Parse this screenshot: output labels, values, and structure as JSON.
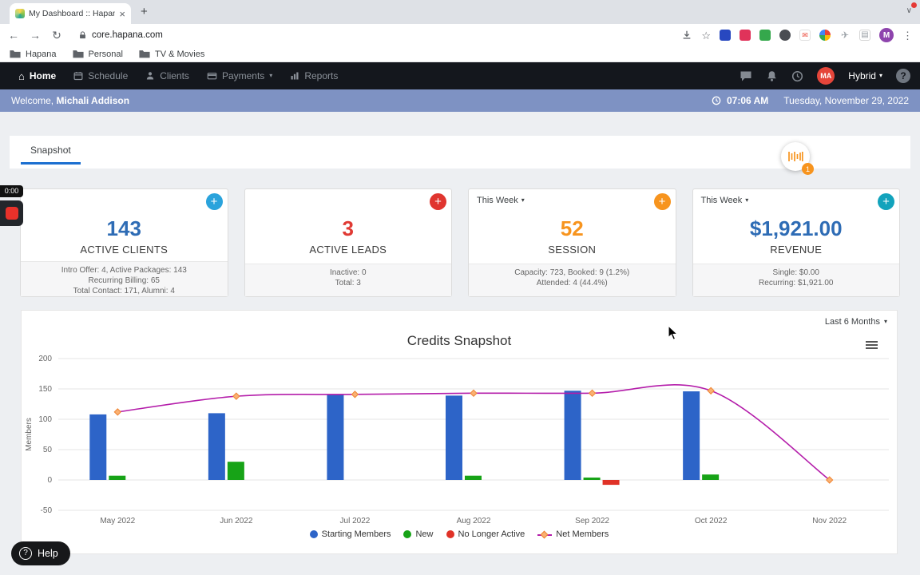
{
  "icons": {
    "close": "×",
    "plus": "+",
    "back": "←",
    "forward": "→",
    "reload": "↻",
    "star": "☆",
    "kebab": "⋮",
    "caret_down": "▾",
    "chevron_down": "∨",
    "house": "⌂",
    "question": "?",
    "envelope": "✉",
    "plane": "✈",
    "notebook": "▤"
  },
  "browser": {
    "tab_title": "My Dashboard :: Hapana | Tak",
    "url": "core.hapana.com",
    "profile_letter": "M",
    "bookmarks": [
      "Hapana",
      "Personal",
      "TV & Movies"
    ]
  },
  "nav": {
    "items": [
      {
        "label": "Home"
      },
      {
        "label": "Schedule"
      },
      {
        "label": "Clients"
      },
      {
        "label": "Payments"
      },
      {
        "label": "Reports"
      }
    ],
    "profile_initials": "MA",
    "profile_role": "Hybrid"
  },
  "welcome": {
    "greeting": "Welcome,",
    "name": "Michali Addison",
    "time": "07:06 AM",
    "date": "Tuesday, November 29, 2022"
  },
  "snapshot": {
    "tab_label": "Snapshot",
    "badge_count": "1"
  },
  "stat_cards": [
    {
      "value": "143",
      "label": "ACTIVE CLIENTS",
      "value_color": "#2e6cb5",
      "plus_color": "#2aa3dc",
      "details": [
        "Intro Offer: 4, Active Packages: 143",
        "Recurring Billing: 65",
        "Total Contact: 171, Alumni: 4"
      ]
    },
    {
      "value": "3",
      "label": "ACTIVE LEADS",
      "value_color": "#e03a34",
      "plus_color": "#e0352f",
      "details": [
        "Inactive: 0",
        "Total: 3"
      ]
    },
    {
      "dropdown": "This Week",
      "value": "52",
      "label": "SESSION",
      "value_color": "#f7941e",
      "plus_color": "#f7941e",
      "details": [
        "Capacity: 723, Booked: 9 (1.2%)",
        "Attended: 4 (44.4%)"
      ]
    },
    {
      "dropdown": "This Week",
      "value": "$1,921.00",
      "label": "REVENUE",
      "value_color": "#2e6cb5",
      "plus_color": "#12a3bc",
      "details": [
        "Single: $0.00",
        "Recurring: $1,921.00"
      ]
    }
  ],
  "chart_card": {
    "range_label": "Last 6 Months"
  },
  "chart_data": {
    "type": "bar+line",
    "title": "Credits Snapshot",
    "ylabel": "Members",
    "ylim": [
      -50,
      200
    ],
    "yticks": [
      200,
      150,
      100,
      50,
      0,
      -50
    ],
    "grid": true,
    "legend_position": "bottom",
    "categories": [
      "May 2022",
      "Jun 2022",
      "Jul 2022",
      "Aug 2022",
      "Sep 2022",
      "Oct 2022",
      "Nov 2022"
    ],
    "series": [
      {
        "name": "Starting Members",
        "type": "bar",
        "color": "#2d64c8",
        "values": [
          108,
          110,
          141,
          139,
          147,
          146,
          null
        ]
      },
      {
        "name": "New",
        "type": "bar",
        "color": "#17a317",
        "values": [
          7,
          30,
          0,
          7,
          4,
          9,
          null
        ]
      },
      {
        "name": "No Longer Active",
        "type": "bar",
        "color": "#e03227",
        "values": [
          0,
          0,
          0,
          0,
          -8,
          0,
          null
        ]
      },
      {
        "name": "Net Members",
        "type": "line",
        "color": "#b41daa",
        "marker_fill": "#f9b173",
        "marker_stroke": "#ef8432",
        "values": [
          112,
          138,
          141,
          143,
          143,
          147,
          0
        ]
      }
    ]
  },
  "recorder": {
    "timer": "0:00"
  },
  "help": {
    "label": "Help"
  }
}
